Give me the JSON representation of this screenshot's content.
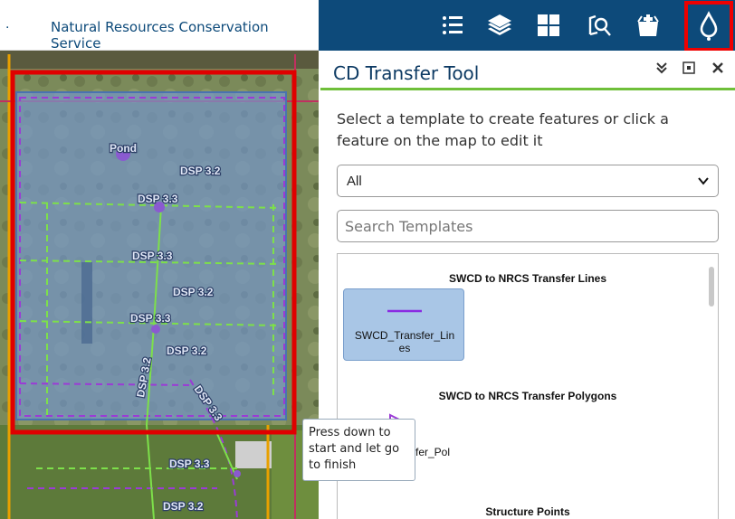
{
  "header": {
    "dot": ".",
    "title": "Natural Resources Conservation Service",
    "tools": [
      {
        "icon": "list-icon"
      },
      {
        "icon": "layers-icon"
      },
      {
        "icon": "grid-icon"
      },
      {
        "icon": "search-map-icon"
      },
      {
        "icon": "basket-icon"
      },
      {
        "icon": "drop-icon",
        "active": true
      }
    ]
  },
  "map": {
    "labels": {
      "pond": "Pond",
      "dsp32_a": "DSP 3.2",
      "dsp33_a": "DSP 3.3",
      "dsp33_b": "DSP 3.3",
      "dsp32_b": "DSP 3.2",
      "dsp33_c": "DSP 3.3",
      "dsp32_c": "DSP 3.2",
      "dsp32_vertical": "DSP 3.2",
      "dsp33_diagonal": "DSP 3.3",
      "dsp33_bottom": "DSP 3.3",
      "dsp32_bottom": "DSP 3.2"
    }
  },
  "panel": {
    "title": "CD Transfer Tool",
    "description": "Select a template to create features or click a feature on the map to edit it",
    "filter_value": "All",
    "search_placeholder": "Search Templates",
    "groups": [
      {
        "title": "SWCD to NRCS Transfer Lines"
      },
      {
        "title": "SWCD to NRCS Transfer Polygons"
      },
      {
        "title": "Structure Points"
      }
    ],
    "template_lines_label_1": "SWCD_Transfer_Lin",
    "template_lines_label_2": "es",
    "template_poly_label_1": "sfer_Pol",
    "template_poly_label_2": "s"
  },
  "tooltip": {
    "line1": "Press down to",
    "line2": "start and let go",
    "line3": "to finish"
  },
  "colors": {
    "header": "#0d4a7a",
    "accent_green": "#6fbf3a",
    "highlight_red": "#e00000",
    "selection_fill": "#7496c8",
    "line_purple": "#8a2be2"
  }
}
